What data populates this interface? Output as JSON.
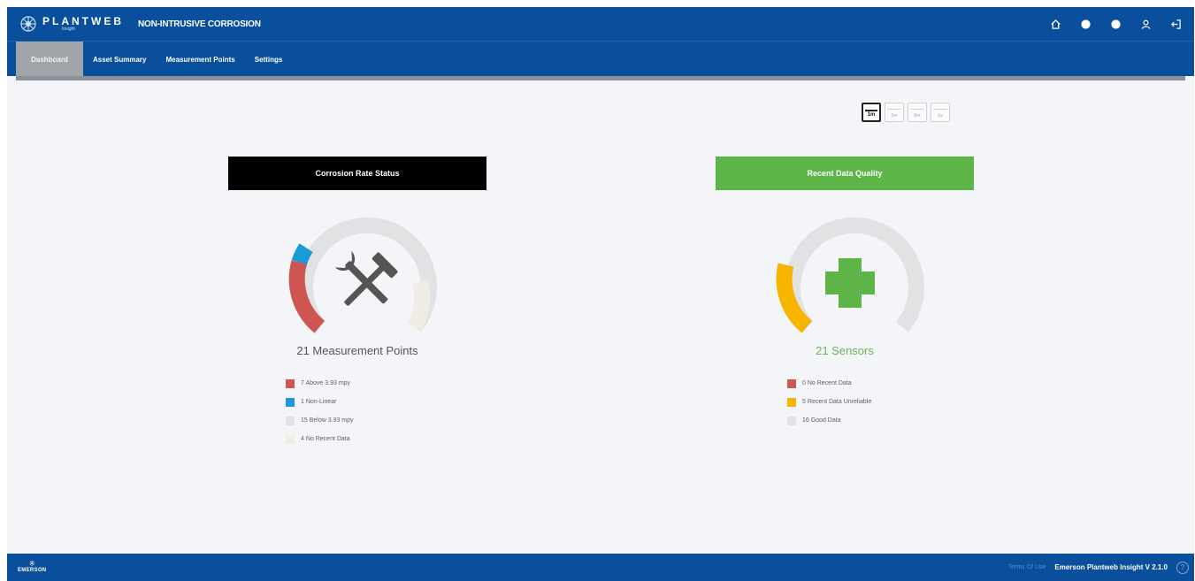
{
  "header": {
    "brand": "PLANTWEB",
    "brand_sub": "Insight",
    "app_title": "NON-INTRUSIVE CORROSION",
    "icons": [
      "home-icon",
      "notifications-icon",
      "help-circle-icon",
      "user-icon",
      "logout-icon"
    ]
  },
  "nav": {
    "tabs": [
      {
        "label": "Dashboard",
        "active": true
      },
      {
        "label": "Asset Summary",
        "active": false
      },
      {
        "label": "Measurement Points",
        "active": false
      },
      {
        "label": "Settings",
        "active": false
      }
    ]
  },
  "time_range": {
    "options": [
      "1m",
      "3m",
      "6m",
      "1y"
    ],
    "selected": "1m"
  },
  "corrosion": {
    "header": "Corrosion Rate Status",
    "title": "21 Measurement Points",
    "icon": "tools-icon",
    "legend": [
      {
        "label": "7 Above 3.93 mpy",
        "color": "#cd5552",
        "value": 7
      },
      {
        "label": "1 Non-Linear",
        "color": "#1b9ad6",
        "value": 1
      },
      {
        "label": "15 Below 3.93 mpy",
        "color": "#e1e2e3",
        "value": 15
      },
      {
        "label": "4 No Recent Data",
        "color": "#efece4",
        "value": 4
      }
    ]
  },
  "quality": {
    "header": "Recent Data Quality",
    "title": "21 Sensors",
    "icon": "plus-icon",
    "legend": [
      {
        "label": "0 No Recent Data",
        "color": "#cd5552",
        "value": 0
      },
      {
        "label": "5 Recent Data Unreliable",
        "color": "#f7b500",
        "value": 5
      },
      {
        "label": "16 Good Data",
        "color": "#e1e2e3",
        "value": 16
      }
    ]
  },
  "footer": {
    "logo": "EMERSON",
    "terms": "Terms Of Use",
    "version": "Emerson Plantweb Insight V 2.1.0",
    "help": "?"
  }
}
